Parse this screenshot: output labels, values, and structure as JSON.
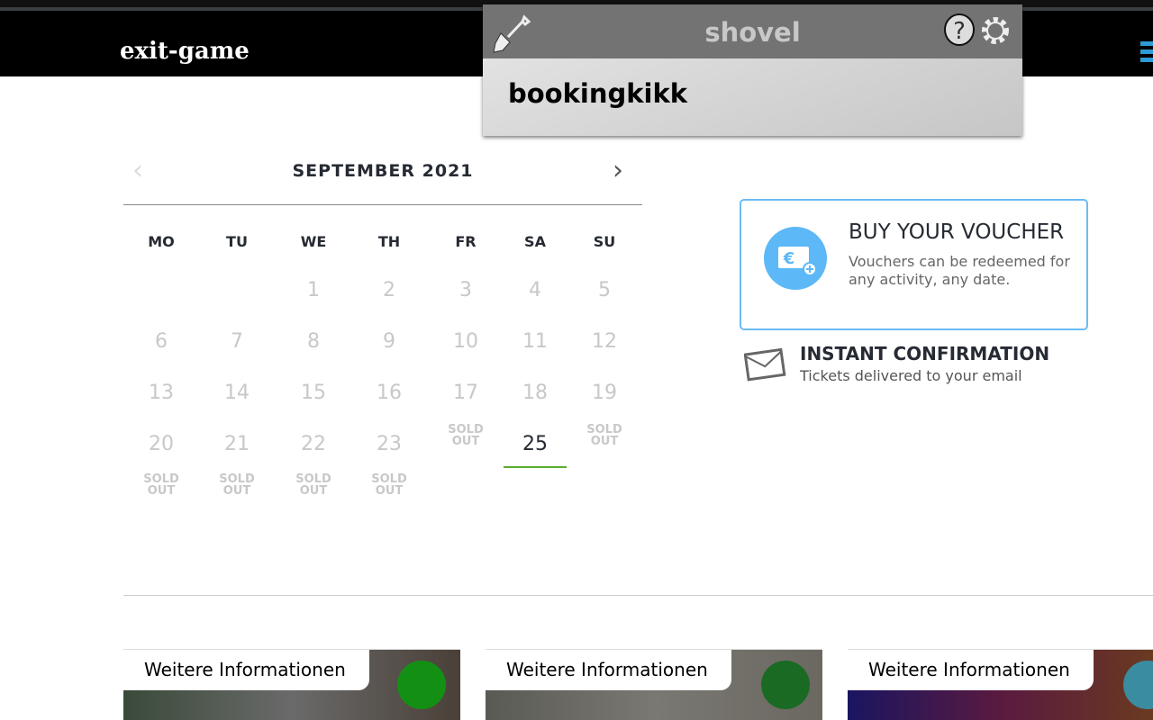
{
  "header": {
    "logo": "exit-game"
  },
  "extension": {
    "title": "shovel",
    "content": "bookingkikk",
    "icons": [
      "shovel-icon",
      "help-icon",
      "gear-icon"
    ]
  },
  "calendar": {
    "month": "SEPTEMBER 2021",
    "weekdays": [
      "MO",
      "TU",
      "WE",
      "TH",
      "FR",
      "SA",
      "SU"
    ],
    "weeks": [
      [
        {
          "t": ""
        },
        {
          "t": ""
        },
        {
          "t": "1"
        },
        {
          "t": "2"
        },
        {
          "t": "3"
        },
        {
          "t": "4"
        },
        {
          "t": "5"
        }
      ],
      [
        {
          "t": "6"
        },
        {
          "t": "7"
        },
        {
          "t": "8"
        },
        {
          "t": "9"
        },
        {
          "t": "10"
        },
        {
          "t": "11"
        },
        {
          "t": "12"
        }
      ],
      [
        {
          "t": "13"
        },
        {
          "t": "14"
        },
        {
          "t": "15"
        },
        {
          "t": "16"
        },
        {
          "t": "17"
        },
        {
          "t": "18"
        },
        {
          "t": "19"
        }
      ],
      [
        {
          "t": "20"
        },
        {
          "t": "21"
        },
        {
          "t": "22"
        },
        {
          "t": "23"
        },
        {
          "t": "SOLD OUT",
          "s": "sold"
        },
        {
          "t": "25",
          "s": "selected"
        },
        {
          "t": "SOLD OUT",
          "s": "sold"
        }
      ],
      [
        {
          "t": "SOLD OUT",
          "s": "sold"
        },
        {
          "t": "SOLD OUT",
          "s": "sold"
        },
        {
          "t": "SOLD OUT",
          "s": "sold"
        },
        {
          "t": "SOLD OUT",
          "s": "sold"
        },
        {
          "t": ""
        },
        {
          "t": ""
        },
        {
          "t": ""
        }
      ]
    ],
    "selected_color": "#5aae2e"
  },
  "voucher": {
    "title": "BUY YOUR VOUCHER",
    "text": "Vouchers can be redeemed for any activity, any date.",
    "accent": "#5cb8f6"
  },
  "confirmation": {
    "title": "INSTANT CONFIRMATION",
    "text": "Tickets delivered to your email"
  },
  "cards": [
    {
      "label": "Weitere Informationen"
    },
    {
      "label": "Weitere Informationen"
    },
    {
      "label": "Weitere Informationen"
    }
  ]
}
